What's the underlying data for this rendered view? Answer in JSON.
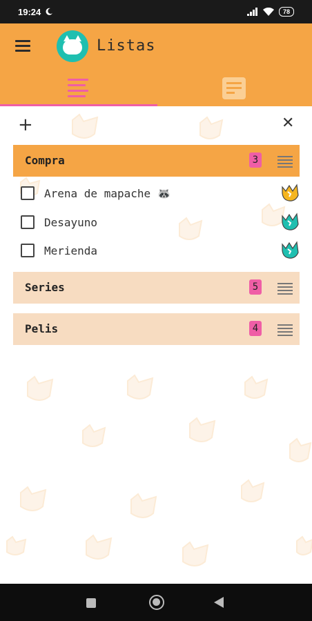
{
  "status_bar": {
    "time": "19:24",
    "battery": "78"
  },
  "app_bar": {
    "title": "Listas"
  },
  "tabs": {
    "lists_tab": "lists-icon",
    "notes_tab": "notes-icon"
  },
  "toolbar": {
    "add_icon": "+",
    "close_icon": "✕"
  },
  "lists": [
    {
      "name": "Compra",
      "count": "3",
      "state": "expanded",
      "items": [
        {
          "label": "Arena de mapache 🦝",
          "checked": false,
          "avatar_color": "#f5b51f"
        },
        {
          "label": "Desayuno",
          "checked": false,
          "avatar_color": "#1fbfb0"
        },
        {
          "label": "Merienda",
          "checked": false,
          "avatar_color": "#1fbfb0"
        }
      ]
    },
    {
      "name": "Series",
      "count": "5",
      "state": "collapsed"
    },
    {
      "name": "Pelis",
      "count": "4",
      "state": "collapsed"
    }
  ],
  "colors": {
    "accent": "#f5a545",
    "pink": "#ef5ea6",
    "collapsed_bg": "#f7dcc1",
    "teal": "#1fbfb0",
    "yellow": "#f5b51f"
  }
}
